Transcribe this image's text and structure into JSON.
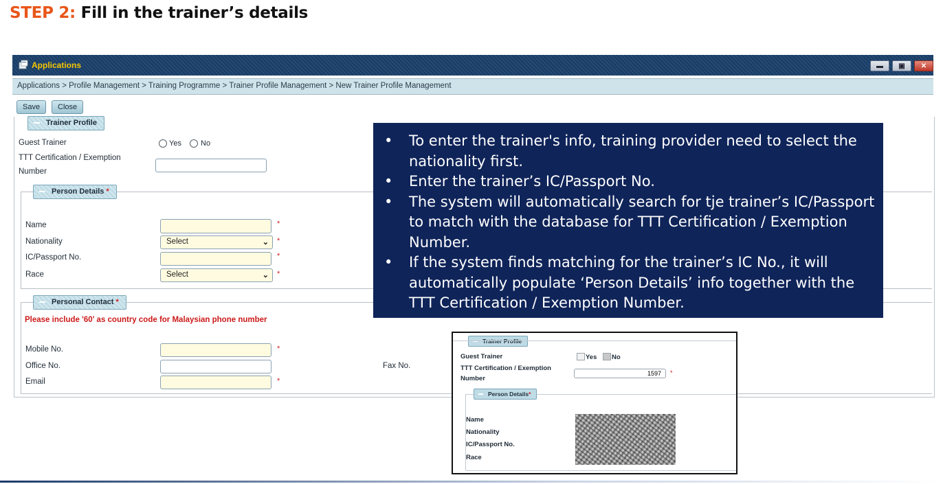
{
  "slide": {
    "step_label": "STEP 2:",
    "title": "Fill in the trainer’s details"
  },
  "window": {
    "title": "Applications",
    "controls": [
      "minimize-icon",
      "maximize-icon",
      "close-icon"
    ]
  },
  "breadcrumb": "Applications  > Profile Management  > Training Programme  > Trainer Profile Management  > New Trainer Profile Management",
  "toolbar": {
    "save_label": "Save",
    "close_label": "Close"
  },
  "trainer_profile": {
    "section_label": "Trainer Profile",
    "guest_trainer_label": "Guest Trainer",
    "yes_label": "Yes",
    "no_label": "No",
    "ttt_label_line1": "TTT Certification / Exemption",
    "ttt_label_line2": "Number",
    "ttt_value": ""
  },
  "person_details": {
    "section_label": "Person Details",
    "required_mark": "*",
    "name_label": "Name",
    "nationality_label": "Nationality",
    "nationality_value": "Select",
    "ic_label": "IC/Passport No.",
    "race_label": "Race",
    "race_value": "Select"
  },
  "personal_contact": {
    "section_label": "Personal Contact",
    "required_mark": "*",
    "note": "Please include '60' as country code for Malaysian phone number",
    "mobile_label": "Mobile No.",
    "office_label": "Office No.",
    "fax_label": "Fax No.",
    "email_label": "Email"
  },
  "callout": {
    "bullet": "•",
    "items": [
      "To enter the trainer's info, training provider need to select the nationality first.",
      "Enter the trainer’s IC/Passport No.",
      "The system will automatically search for tje trainer’s IC/Passport to match with the database for TTT Certification / Exemption Number.",
      "If the system finds matching for the trainer’s IC No., it will automatically populate ‘Person Details’ info together with the TTT Certification / Exemption Number."
    ]
  },
  "inset": {
    "section_label": "Trainer Profile",
    "guest_trainer_label": "Guest Trainer",
    "yes_label": "Yes",
    "no_label": "No",
    "ttt_label_line1": "TTT Certification / Exemption",
    "ttt_label_line2": "Number",
    "ttt_value": "1597",
    "person_section_label": "Person Details",
    "name_label": "Name",
    "nationality_label": "Nationality",
    "ic_label": "IC/Passport No.",
    "race_label": "Race"
  },
  "colors": {
    "step_accent": "#e8561a",
    "titlebar": "#173c66",
    "callout_bg": "#0f2459",
    "required": "#d02020"
  }
}
